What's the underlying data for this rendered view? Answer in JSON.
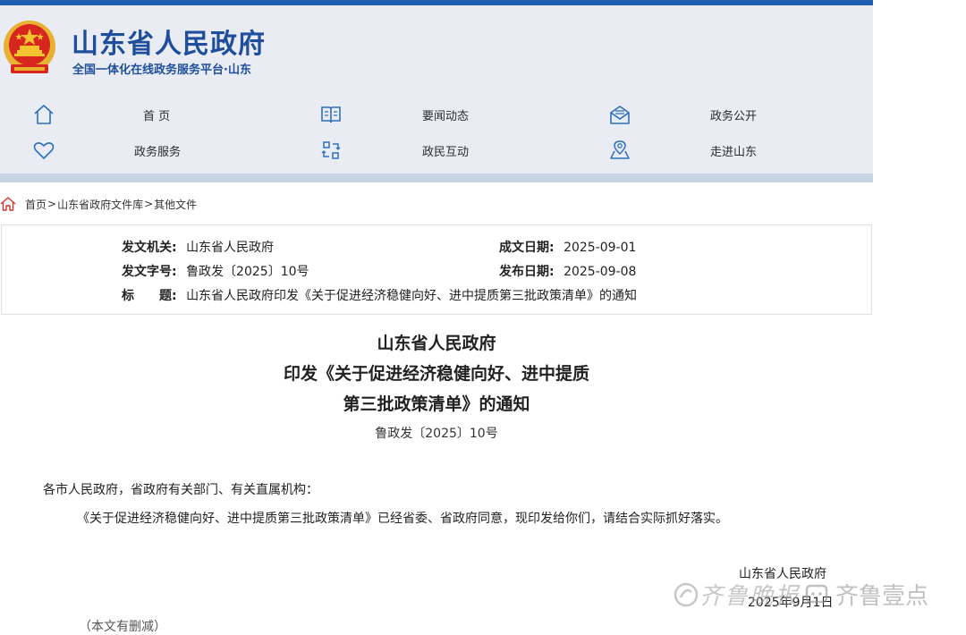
{
  "header": {
    "site_title": "山东省人民政府",
    "site_subtitle": "全国一体化在线政务服务平台·山东",
    "colors": {
      "brand": "#1f4f9c",
      "topbar": "#1d5fae",
      "header_bg": "#e9ecf3"
    }
  },
  "nav": [
    {
      "label": "首 页",
      "icon": "home-icon"
    },
    {
      "label": "要闻动态",
      "icon": "book-icon"
    },
    {
      "label": "政务公开",
      "icon": "mail-open-icon"
    },
    {
      "label": "政务服务",
      "icon": "heart-icon"
    },
    {
      "label": "政民互动",
      "icon": "exchange-icon"
    },
    {
      "label": "走进山东",
      "icon": "map-pin-icon"
    }
  ],
  "breadcrumb": {
    "home": "首页",
    "library": "山东省政府文件库",
    "current": "其他文件"
  },
  "meta": {
    "issuer_label": "发文机关:",
    "issuer": "山东省人民政府",
    "created_label": "成文日期:",
    "created": "2025-09-01",
    "docno_label": "发文字号:",
    "docno": "鲁政发〔2025〕10号",
    "published_label": "发布日期:",
    "published": "2025-09-08",
    "title_label": "标　　题:",
    "title": "山东省人民政府印发《关于促进经济稳健向好、进中提质第三批政策清单》的通知"
  },
  "document": {
    "title_line1": "山东省人民政府",
    "title_line2": "印发《关于促进经济稳健向好、进中提质",
    "title_line3": "第三批政策清单》的通知",
    "number": "鲁政发〔2025〕10号",
    "salutation": "各市人民政府，省政府有关部门、有关直属机构：",
    "paragraph1": "《关于促进经济稳健向好、进中提质第三批政策清单》已经省委、省政府同意，现印发给你们，请结合实际抓好落实。",
    "signature": "山东省人民政府",
    "date": "2025年9月1日",
    "note": "（本文有删减）"
  },
  "watermark": {
    "text": "齐鲁晚报",
    "brand": "齐鲁壹点"
  }
}
